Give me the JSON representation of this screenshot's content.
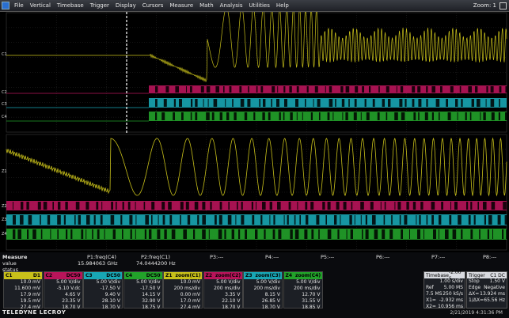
{
  "menubar": {
    "items": [
      "File",
      "Vertical",
      "Timebase",
      "Trigger",
      "Display",
      "Cursors",
      "Measure",
      "Math",
      "Analysis",
      "Utilities",
      "Help"
    ],
    "zoom": "Zoom: 1"
  },
  "colors": {
    "yellow": "#c8c01a",
    "magenta": "#b8145a",
    "cyan": "#18a6b4",
    "green": "#22a22a",
    "dashed": "#ffffff"
  },
  "measure": {
    "header": "Measure",
    "value_label": "value",
    "status_label": "status",
    "p1_name": "P1:freq(C4)",
    "p1_value": "15.984063 GHz",
    "p2_name": "P2:freq(C1)",
    "p2_value": "74.0444200 Hz",
    "p_labels": [
      "P3:---",
      "P4:---",
      "P5:---",
      "P6:---",
      "P7:---",
      "P8:---"
    ]
  },
  "dialogs": [
    {
      "name": "C1",
      "color": "#c8c01a",
      "hd": "D1",
      "lines": [
        "10.0 mV",
        "11.600 mV",
        "17.9 mV",
        "19.5 mV",
        "27.4 mV"
      ]
    },
    {
      "name": "C2",
      "color": "#b8145a",
      "hd": "DC50",
      "lines": [
        "5.00 V/div",
        "-5.10 V.dc",
        "4.65 V",
        "23.35 V",
        "18.70 V"
      ]
    },
    {
      "name": "C3",
      "color": "#18a6b4",
      "hd": "DC50",
      "lines": [
        "5.00 V/div",
        "-17.50 V",
        "9.40 V",
        "28.10 V",
        "18.70 V"
      ]
    },
    {
      "name": "C4",
      "color": "#22a22a",
      "hd": "DC50",
      "lines": [
        "5.00 V/div",
        "-17.50 V",
        "14.15 V",
        "32.90 V",
        "18.75 V"
      ]
    },
    {
      "name": "Z1",
      "color": "#c8c01a",
      "hd": "zoom(C1)",
      "lines": [
        "10.0 mV",
        "200 ms/div",
        "0.00 mV",
        "17.0 mV",
        "27.4 mV"
      ]
    },
    {
      "name": "Z2",
      "color": "#b8145a",
      "hd": "zoom(C2)",
      "lines": [
        "5.00 V/div",
        "200 ms/div",
        "3.35 V",
        "22.10 V",
        "18.70 V"
      ]
    },
    {
      "name": "Z3",
      "color": "#18a6b4",
      "hd": "zoom(C3)",
      "lines": [
        "5.00 V/div",
        "200 ms/div",
        "8.15 V",
        "26.85 V",
        "18.70 V"
      ]
    },
    {
      "name": "Z4",
      "color": "#22a22a",
      "hd": "zoom(C4)",
      "lines": [
        "5.00 V/div",
        "200 ms/div",
        "12.70 V",
        "31.55 V",
        "18.85 V"
      ]
    }
  ],
  "timebase": {
    "title": "Timebase",
    "offset": "-2.00 s",
    "lines": [
      [
        "",
        "1.00 s/div"
      ],
      [
        "Ref",
        "5.00 MS"
      ],
      [
        "7.5 MS",
        "250 kS/s"
      ],
      [
        "X1=",
        "-2.932 ms"
      ],
      [
        "X2=",
        "10.956 ms"
      ]
    ]
  },
  "trigger": {
    "title": "Trigger",
    "mode": "C1 DC",
    "lines": [
      [
        "Stop",
        "1.50 V"
      ],
      [
        "Edge",
        "Negative"
      ],
      [
        "ΔX=",
        "13.924 ms"
      ],
      [
        "1/ΔX=",
        "65.56 Hz"
      ],
      [
        "",
        ""
      ]
    ]
  },
  "brand": "TELEDYNE LECROY",
  "datetime": "2/21/2019 4:31:36 PM"
}
